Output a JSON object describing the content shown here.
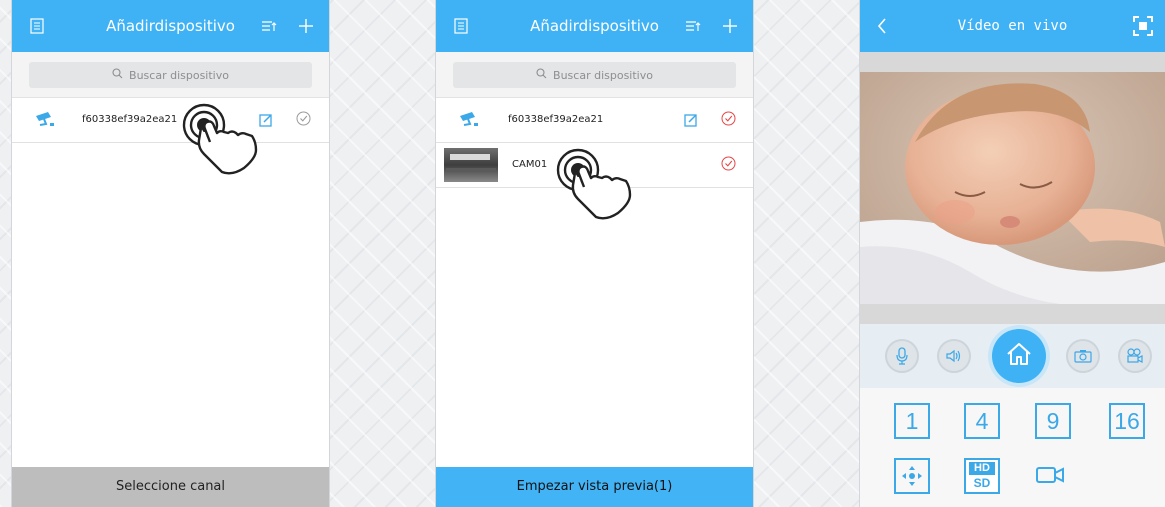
{
  "screen1": {
    "title": "Añadirdispositivo",
    "search_placeholder": "Buscar dispositivo",
    "device_name": "f60338ef39a2ea21",
    "bottom_label": "Seleccione canal"
  },
  "screen2": {
    "title": "Añadirdispositivo",
    "search_placeholder": "Buscar dispositivo",
    "device_name": "f60338ef39a2ea21",
    "channel_name": "CAM01",
    "bottom_label": "Empezar vista previa(1)"
  },
  "screen3": {
    "title": "Vídeo en vivo",
    "layouts": [
      "1",
      "4",
      "9",
      "16"
    ],
    "hd_label": "HD",
    "sd_label": "SD"
  },
  "colors": {
    "accent": "#3eb2f5",
    "bottom_grey": "#bdbdbd",
    "check_red": "#e64545"
  }
}
